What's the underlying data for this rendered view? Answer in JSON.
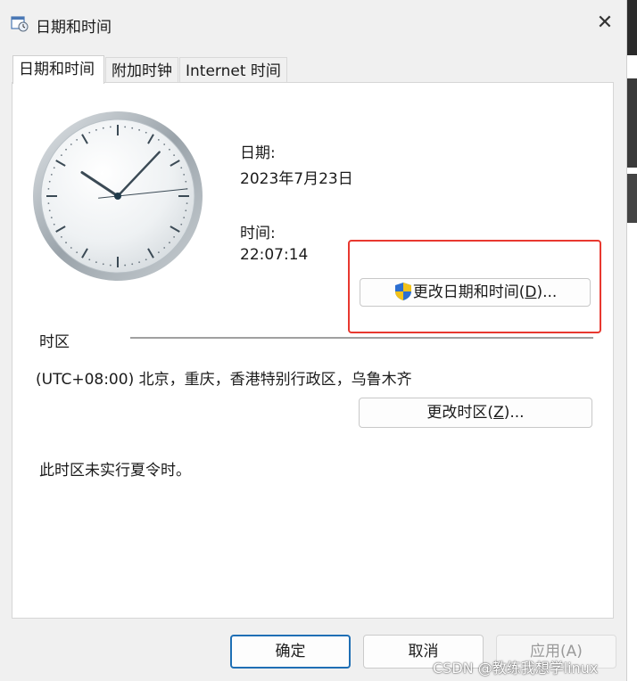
{
  "window": {
    "title": "日期和时间",
    "close_icon": "close-icon"
  },
  "tabs": [
    {
      "label": "日期和时间",
      "active": true
    },
    {
      "label": "附加时钟",
      "active": false
    },
    {
      "label": "Internet 时间",
      "active": false
    }
  ],
  "datetime": {
    "date_label": "日期:",
    "date_value": "2023年7月23日",
    "time_label": "时间:",
    "time_value": "22:07:14",
    "change_button": {
      "text": "更改日期和时间(",
      "accel": "D",
      "suffix": ")..."
    }
  },
  "timezone": {
    "header": "时区",
    "value": "(UTC+08:00) 北京，重庆，香港特别行政区，乌鲁木齐",
    "change_button": {
      "text": "更改时区(",
      "accel": "Z",
      "suffix": ")..."
    },
    "dst_note": "此时区未实行夏令时。"
  },
  "footer": {
    "ok": "确定",
    "cancel": "取消",
    "apply": "应用(A)"
  },
  "watermark": "CSDN @教练我想学linux",
  "clock_time": {
    "hour": 22,
    "minute": 7,
    "second": 14
  },
  "colors": {
    "highlight_border": "#e8382f",
    "default_button_border": "#1f6fb5"
  }
}
